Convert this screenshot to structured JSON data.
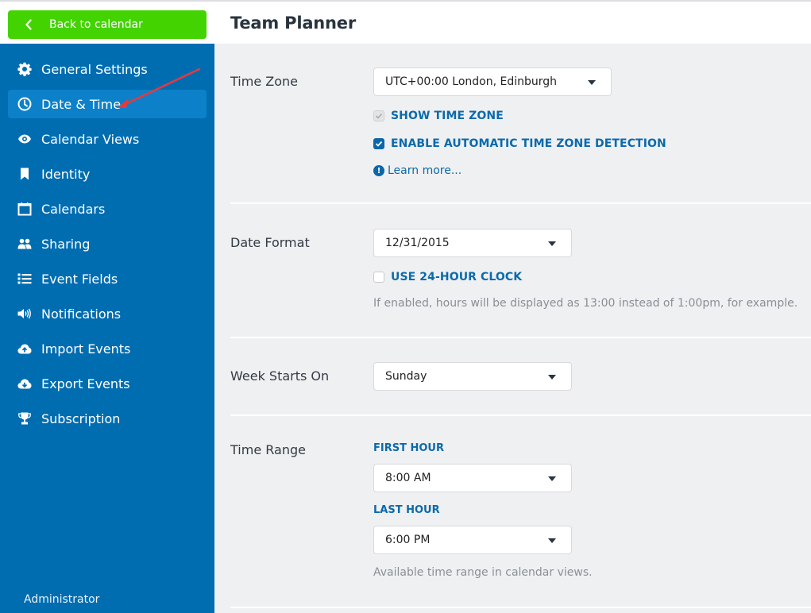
{
  "back_button": {
    "label": "Back to calendar",
    "icon": "chevron-left-icon"
  },
  "header": {
    "title": "Team Planner"
  },
  "sidebar": {
    "items": [
      {
        "label": "General Settings",
        "icon": "gear-icon",
        "active": false
      },
      {
        "label": "Date & Time",
        "icon": "clock-icon",
        "active": true
      },
      {
        "label": "Calendar Views",
        "icon": "eye-icon",
        "active": false
      },
      {
        "label": "Identity",
        "icon": "bookmark-icon",
        "active": false
      },
      {
        "label": "Calendars",
        "icon": "calendar-icon",
        "active": false
      },
      {
        "label": "Sharing",
        "icon": "users-icon",
        "active": false
      },
      {
        "label": "Event Fields",
        "icon": "list-icon",
        "active": false
      },
      {
        "label": "Notifications",
        "icon": "volume-icon",
        "active": false
      },
      {
        "label": "Import Events",
        "icon": "cloud-upload-icon",
        "active": false
      },
      {
        "label": "Export Events",
        "icon": "cloud-download-icon",
        "active": false
      },
      {
        "label": "Subscription",
        "icon": "trophy-icon",
        "active": false
      }
    ],
    "footer_user": "Administrator"
  },
  "settings": {
    "time_zone": {
      "label": "Time Zone",
      "value": "UTC+00:00 London, Edinburgh",
      "show_time_zone": {
        "label": "SHOW TIME ZONE",
        "checked": true,
        "disabled": true
      },
      "auto_detect": {
        "label": "ENABLE AUTOMATIC TIME ZONE DETECTION",
        "checked": true
      },
      "learn_more": "Learn more..."
    },
    "date_format": {
      "label": "Date Format",
      "value": "12/31/2015",
      "use_24h": {
        "label": "USE 24-HOUR CLOCK",
        "checked": false
      },
      "help": "If enabled, hours will be displayed as 13:00 instead of 1:00pm, for example."
    },
    "week_start": {
      "label": "Week Starts On",
      "value": "Sunday"
    },
    "time_range": {
      "label": "Time Range",
      "first_hour_label": "FIRST HOUR",
      "first_hour": "8:00 AM",
      "last_hour_label": "LAST HOUR",
      "last_hour": "6:00 PM",
      "help": "Available time range in calendar views."
    }
  },
  "colors": {
    "sidebar": "#006db1",
    "sidebar_active": "#0c81c9",
    "back_button": "#43d300",
    "accent_text": "#0b6aaa",
    "annotation_arrow": "#e8383d"
  }
}
